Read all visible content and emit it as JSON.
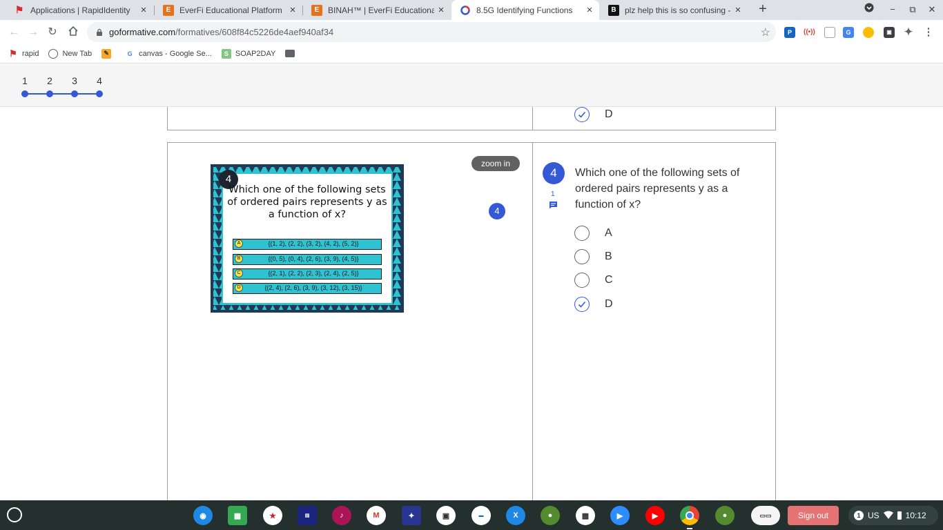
{
  "browser": {
    "tabs": [
      {
        "title": "Applications | RapidIdentity",
        "icon": "rapididentity-icon",
        "color": "#d32f2f",
        "active": false
      },
      {
        "title": "EverFi Educational Platform",
        "icon": "everfi-icon",
        "color": "#e8711c",
        "active": false
      },
      {
        "title": "BINAH™ | EverFi Educational Pla",
        "icon": "everfi-icon",
        "color": "#e8711c",
        "active": false
      },
      {
        "title": "8.5G Identifying Functions",
        "icon": "formative-icon",
        "color": "#3558d6",
        "active": true
      },
      {
        "title": "plz help this is so confusing - Br",
        "icon": "brainly-icon",
        "color": "#111111",
        "active": false
      }
    ],
    "url_host": "goformative.com",
    "url_path": "/formatives/608f84c5226de4aef940af34",
    "bookmarks": [
      {
        "label": "rapid",
        "icon": "rapid-icon"
      },
      {
        "label": "New Tab",
        "icon": "globe-icon"
      },
      {
        "label": "",
        "icon": "bookmark-app-icon"
      },
      {
        "label": "canvas - Google Se...",
        "icon": "google-icon"
      },
      {
        "label": "SOAP2DAY",
        "icon": "soap2day-icon"
      },
      {
        "label": "",
        "icon": "folder-icon"
      }
    ]
  },
  "question_nav": {
    "numbers": [
      "1",
      "2",
      "3",
      "4"
    ]
  },
  "prev_question": {
    "visible_option": "D",
    "selected": true
  },
  "question": {
    "number": "4",
    "text": "Which one of the following sets of ordered pairs represents y as a function of x?",
    "comment_count": "1",
    "zoom_label": "zoom in",
    "image_badge": "4",
    "options": [
      {
        "label": "A",
        "selected": false
      },
      {
        "label": "B",
        "selected": false
      },
      {
        "label": "C",
        "selected": false
      },
      {
        "label": "D",
        "selected": true
      }
    ]
  },
  "slide": {
    "number": "4",
    "title": "Which one of the following sets of ordered pairs represents y as a function of x?",
    "rows": [
      {
        "letter": "A",
        "text": "{(1, 2), (2, 2), (3, 2), (4, 2), (5, 2)}"
      },
      {
        "letter": "B",
        "text": "{(0, 5), (0, 4), (2, 6), (3, 9), (4, 5)}"
      },
      {
        "letter": "C",
        "text": "{(2, 1), (2, 2), (2, 3), (2, 4), (2, 5)}"
      },
      {
        "letter": "D",
        "text": "{(2, 4), (2, 6), (3, 9), (3, 12), (3, 15)}"
      }
    ]
  },
  "shelf": {
    "signout_label": "Sign out",
    "notification_count": "1",
    "locale": "US",
    "time": "10:12"
  }
}
